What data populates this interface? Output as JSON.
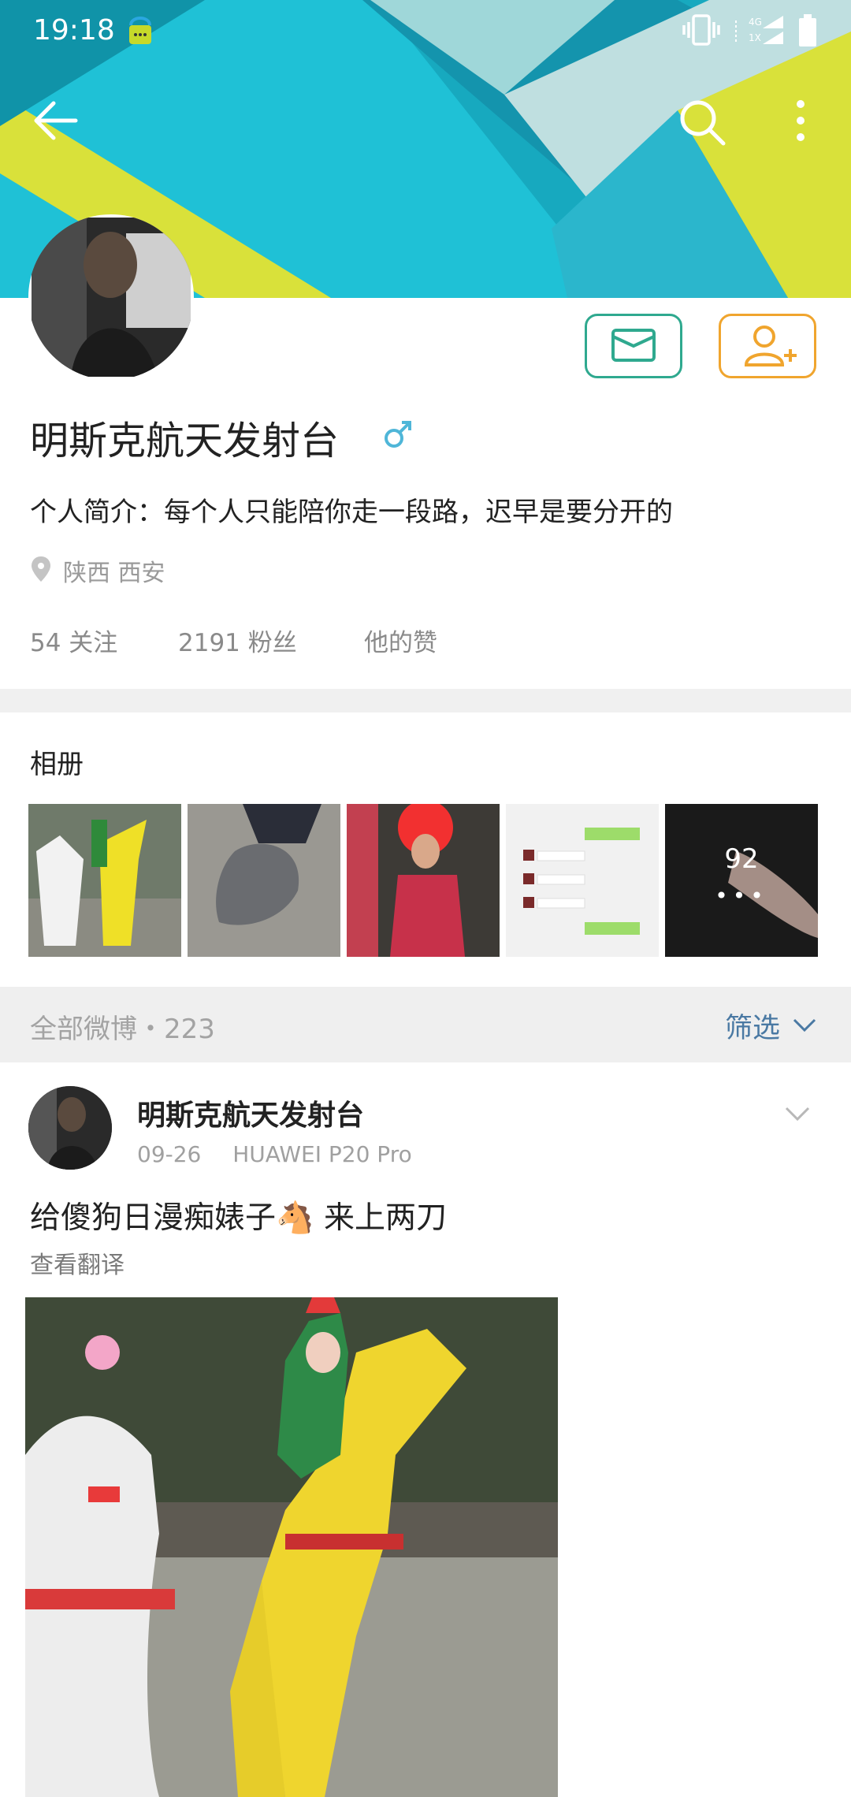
{
  "status_bar": {
    "time": "19:18",
    "network_label_top": "4G",
    "network_label_bottom": "1X"
  },
  "toolbar": {
    "back_icon": "arrow-left-icon",
    "search_icon": "search-icon",
    "more_icon": "more-vertical-icon"
  },
  "profile": {
    "name": "明斯克航天发射台",
    "gender_icon": "male-icon",
    "bio": "个人简介：每个人只能陪你走一段路，迟早是要分开的",
    "location": "陕西 西安",
    "stats": {
      "following": "54 关注",
      "followers": "2191 粉丝",
      "likes": "他的赞"
    },
    "buttons": {
      "message_icon": "message-icon",
      "follow_icon": "add-user-icon"
    }
  },
  "album": {
    "title": "相册",
    "more_count": "92",
    "more_dots": "•••"
  },
  "weibo_bar": {
    "label": "全部微博・223",
    "filter": "筛选"
  },
  "post": {
    "author": "明斯克航天发射台",
    "date": "09-26",
    "device": "HUAWEI P20 Pro",
    "text_before": "给傻狗日漫痴婊子",
    "emoji": "🐴",
    "text_after": " 来上两刀",
    "translate": "查看翻译"
  },
  "colors": {
    "banner_teal": "#19b5c9",
    "banner_yellow": "#d9e13a",
    "message_border": "#2fa98f",
    "follow_border": "#f0a52e",
    "filter_blue": "#4a79a3",
    "gender_blue": "#4fb6d8"
  }
}
